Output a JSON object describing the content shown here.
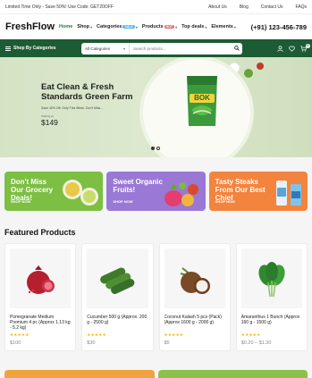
{
  "topbar": {
    "promo_text": "Limited Time Only - Save 50%! Use Code: GET20OFF",
    "links": [
      "About Us",
      "Blog",
      "Contact Us",
      "FAQs"
    ]
  },
  "header": {
    "logo": "FreshFlow",
    "nav": [
      {
        "label": "Home",
        "active": true
      },
      {
        "label": "Shop",
        "chevron": true
      },
      {
        "label": "Categories",
        "badge": "SALE",
        "chevron": true
      },
      {
        "label": "Products",
        "badge": "HOT",
        "chevron": true
      },
      {
        "label": "Top deals",
        "chevron": true
      },
      {
        "label": "Elements",
        "chevron": true
      }
    ],
    "phone": "(+91) 123-456-789"
  },
  "catbar": {
    "shop_by": "Shop By Categories",
    "select_value": "All Categories",
    "search_placeholder": "Search products...",
    "cart_count": "0"
  },
  "hero": {
    "title": "Eat Clean & Fresh Standards Green Farm",
    "subtitle": "Save 40% Off. Only This Week. Don't Miss...",
    "start_label": "Starting at",
    "price": "$149",
    "bag_label": "BOK"
  },
  "promos": [
    {
      "title": "Don't Miss Our Grocery Deals!",
      "cta": "SHOP NOW"
    },
    {
      "title": "Sweet Organic Fruits!",
      "cta": "SHOP NOW"
    },
    {
      "title": "Tasty Steaks From Our Best Chief",
      "cta": "SHOP NOW"
    }
  ],
  "featured": {
    "title": "Featured Products",
    "items": [
      {
        "name": "Pomegranate Medium Premium 4 pc (Approx 1.13 kg - 5.2 kg)",
        "stars": "★★★★★",
        "price": "$100"
      },
      {
        "name": "Cucumber 500 g (Approx. 200 g - 2500 g)",
        "stars": "★★★★★",
        "price": "$30"
      },
      {
        "name": "Coconut Kalash 5 pcs (Pack) (Approx 1600 g - 2000 g)",
        "stars": "★★★★★",
        "price": "$5"
      },
      {
        "name": "Amaranthus 1 Bunch (Approx 160 g - 1500 g)",
        "stars": "★★★★★",
        "price": "$0.20 – $1.30"
      }
    ]
  }
}
